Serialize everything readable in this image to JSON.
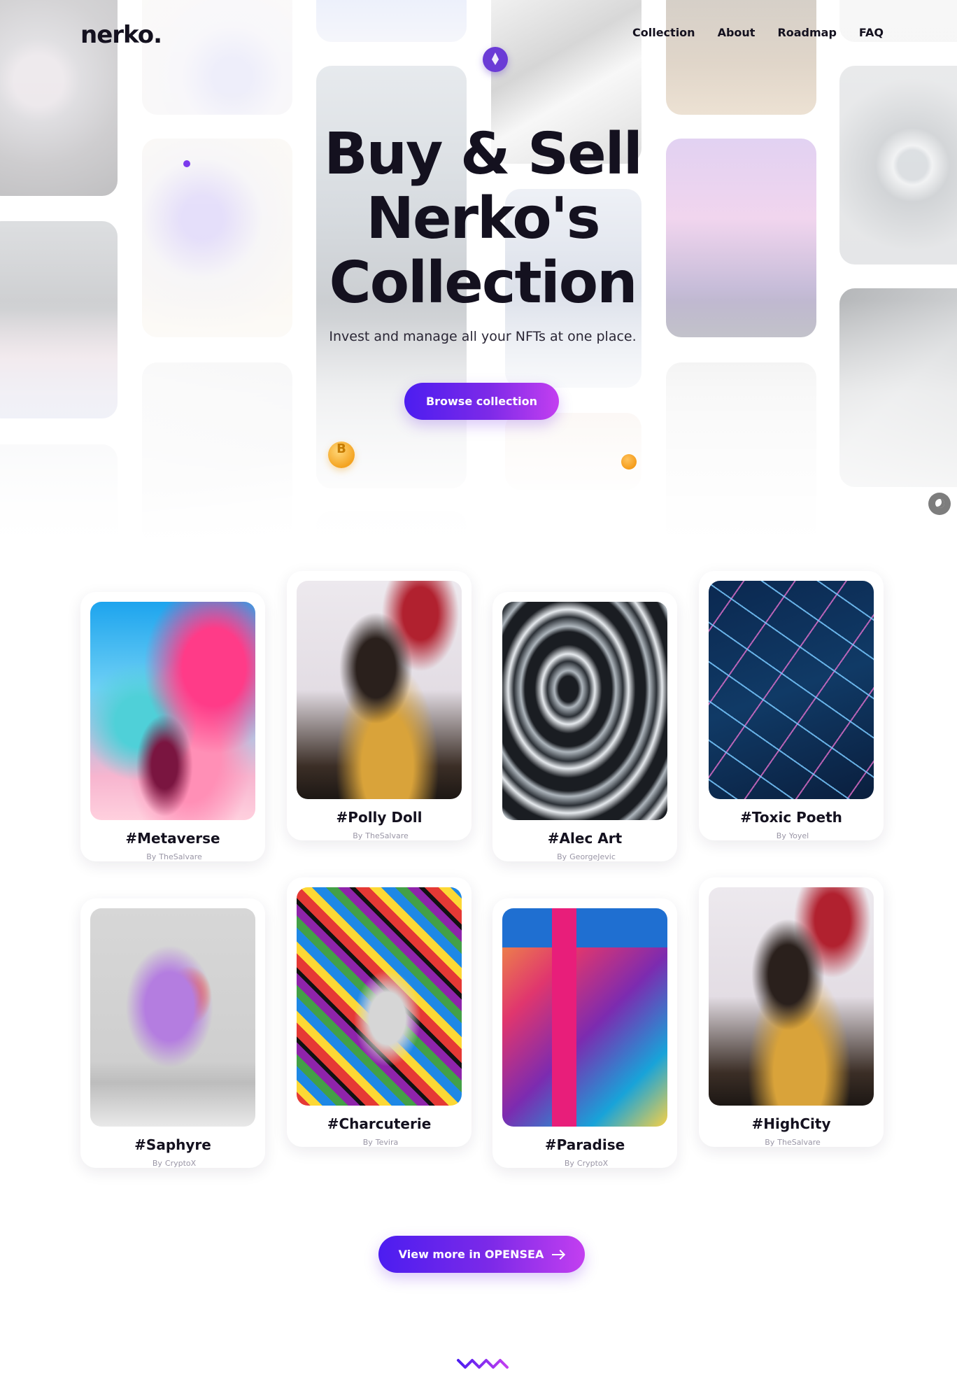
{
  "brand": {
    "logo": "nerko."
  },
  "nav": {
    "items": [
      "Collection",
      "About",
      "Roadmap",
      "FAQ"
    ]
  },
  "hero": {
    "title": "Buy & Sell Nerko's Collection",
    "subtitle": "Invest and manage all your NFTs at one place.",
    "cta": "Browse collection"
  },
  "collection": {
    "cards": [
      {
        "name": "#Metaverse",
        "author": "TheSalvare"
      },
      {
        "name": "#Polly Doll",
        "author": "TheSalvare"
      },
      {
        "name": "#Alec Art",
        "author": "GeorgeJevic"
      },
      {
        "name": "#Toxic Poeth",
        "author": "Yoyel"
      },
      {
        "name": "#Saphyre",
        "author": "CryptoX"
      },
      {
        "name": "#Charcuterie",
        "author": "Tevira"
      },
      {
        "name": "#Paradise",
        "author": "CryptoX"
      },
      {
        "name": "#HighCity",
        "author": "TheSalvare"
      }
    ],
    "by_label": "By"
  },
  "opensea": {
    "label": "View more in OPENSEA"
  },
  "colors": {
    "accent_start": "#4c1df0",
    "accent_end": "#c33ff0",
    "text": "#14111f"
  }
}
